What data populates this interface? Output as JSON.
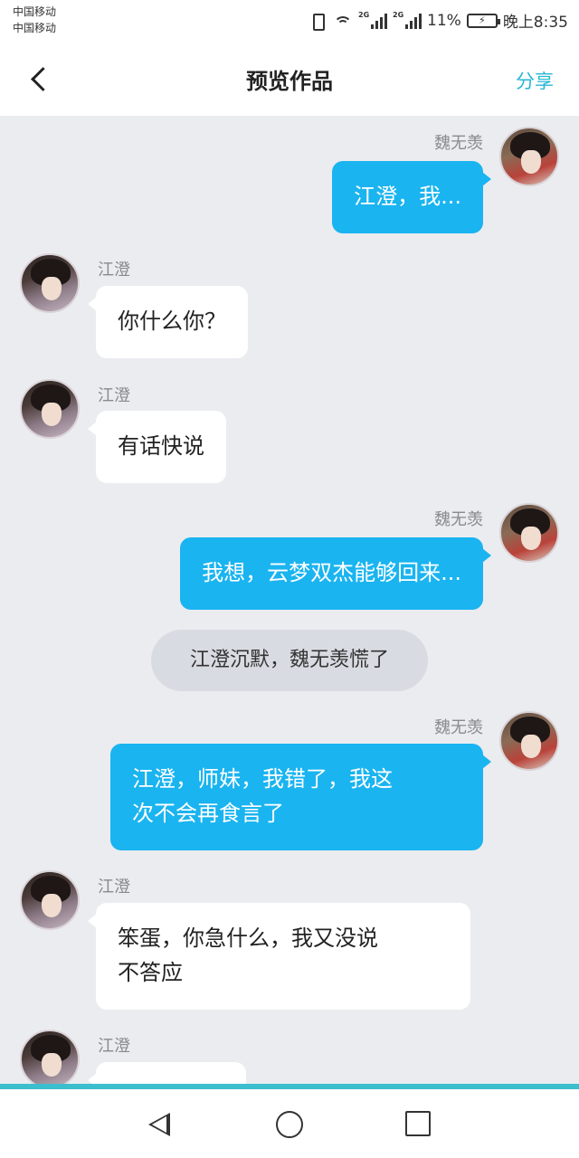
{
  "status_bar": {
    "carrier_1": "中国移动",
    "carrier_2": "中国移动",
    "network_1": "2G",
    "network_2": "2G",
    "battery": "11%",
    "time": "晚上8:35"
  },
  "header": {
    "title": "预览作品",
    "share": "分享"
  },
  "messages": [
    {
      "side": "right",
      "name": "魏无羡",
      "text": "江澄，我..."
    },
    {
      "side": "left",
      "name": "江澄",
      "text": "你什么你？"
    },
    {
      "side": "left",
      "name": "江澄",
      "text": "有话快说"
    },
    {
      "side": "right",
      "name": "魏无羡",
      "text": "我想，云梦双杰能够回来..."
    },
    {
      "side": "center",
      "text": "江澄沉默，魏无羡慌了"
    },
    {
      "side": "right",
      "name": "魏无羡",
      "line1": "江澄，师妹，我错了，我这",
      "line2": "次不会再食言了"
    },
    {
      "side": "left",
      "name": "江澄",
      "line1": "笨蛋，你急什么，我又没说",
      "line2": "不答应"
    },
    {
      "side": "left",
      "name": "江澄",
      "text": ""
    }
  ],
  "colors": {
    "background": "#ebecf0",
    "my_bubble": "#1ab4f0",
    "their_bubble": "#ffffff",
    "accent": "#27b7d6"
  },
  "nav": {
    "back_icon": "triangle-back",
    "home_icon": "circle-home",
    "recent_icon": "square-recent"
  }
}
